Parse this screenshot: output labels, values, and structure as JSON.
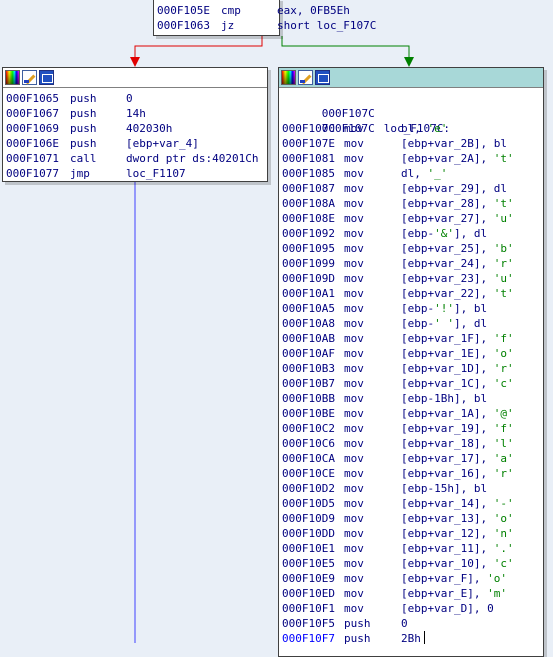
{
  "top_block": {
    "lines": [
      {
        "addr": "000F105E",
        "mn": "cmp",
        "ops": "eax, 0FB5Eh"
      },
      {
        "addr": "000F1063",
        "mn": "jz",
        "ops": "short loc_F107C"
      }
    ]
  },
  "left_block": {
    "header_icons": [
      "color-palette-icon",
      "edit-icon",
      "graph-icon"
    ],
    "lines": [
      {
        "addr": "000F1065",
        "mn": "push",
        "ops": "0"
      },
      {
        "addr": "000F1067",
        "mn": "push",
        "ops": "14h"
      },
      {
        "addr": "000F1069",
        "mn": "push",
        "ops": "402030h"
      },
      {
        "addr": "000F106E",
        "mn": "push",
        "ops": "[ebp+var_4]"
      },
      {
        "addr": "000F1071",
        "mn": "call",
        "ops": "dword ptr ds:40201Ch"
      },
      {
        "addr": "000F1077",
        "mn": "jmp",
        "ops": "loc_F1107"
      }
    ]
  },
  "right_block": {
    "header_icons": [
      "color-palette-icon",
      "edit-icon",
      "graph-icon"
    ],
    "header_color": "#a8d8d8",
    "first_addr": "000F107C",
    "label_line": {
      "addr": "000F107C",
      "label": "loc_F107C:"
    },
    "lines": [
      {
        "addr": "000F107C",
        "mn": "mov",
        "ops": "bl, 'e'"
      },
      {
        "addr": "000F107E",
        "mn": "mov",
        "ops": "[ebp+var_2B], bl"
      },
      {
        "addr": "000F1081",
        "mn": "mov",
        "ops": "[ebp+var_2A], 't'"
      },
      {
        "addr": "000F1085",
        "mn": "mov",
        "ops": "dl, '_'"
      },
      {
        "addr": "000F1087",
        "mn": "mov",
        "ops": "[ebp+var_29], dl"
      },
      {
        "addr": "000F108A",
        "mn": "mov",
        "ops": "[ebp+var_28], 't'"
      },
      {
        "addr": "000F108E",
        "mn": "mov",
        "ops": "[ebp+var_27], 'u'"
      },
      {
        "addr": "000F1092",
        "mn": "mov",
        "ops": "[ebp-'&'], dl"
      },
      {
        "addr": "000F1095",
        "mn": "mov",
        "ops": "[ebp+var_25], 'b'"
      },
      {
        "addr": "000F1099",
        "mn": "mov",
        "ops": "[ebp+var_24], 'r'"
      },
      {
        "addr": "000F109D",
        "mn": "mov",
        "ops": "[ebp+var_23], 'u'"
      },
      {
        "addr": "000F10A1",
        "mn": "mov",
        "ops": "[ebp+var_22], 't'"
      },
      {
        "addr": "000F10A5",
        "mn": "mov",
        "ops": "[ebp-'!'], bl"
      },
      {
        "addr": "000F10A8",
        "mn": "mov",
        "ops": "[ebp-' '], dl"
      },
      {
        "addr": "000F10AB",
        "mn": "mov",
        "ops": "[ebp+var_1F], 'f'"
      },
      {
        "addr": "000F10AF",
        "mn": "mov",
        "ops": "[ebp+var_1E], 'o'"
      },
      {
        "addr": "000F10B3",
        "mn": "mov",
        "ops": "[ebp+var_1D], 'r'"
      },
      {
        "addr": "000F10B7",
        "mn": "mov",
        "ops": "[ebp+var_1C], 'c'"
      },
      {
        "addr": "000F10BB",
        "mn": "mov",
        "ops": "[ebp-1Bh], bl"
      },
      {
        "addr": "000F10BE",
        "mn": "mov",
        "ops": "[ebp+var_1A], '@'"
      },
      {
        "addr": "000F10C2",
        "mn": "mov",
        "ops": "[ebp+var_19], 'f'"
      },
      {
        "addr": "000F10C6",
        "mn": "mov",
        "ops": "[ebp+var_18], 'l'"
      },
      {
        "addr": "000F10CA",
        "mn": "mov",
        "ops": "[ebp+var_17], 'a'"
      },
      {
        "addr": "000F10CE",
        "mn": "mov",
        "ops": "[ebp+var_16], 'r'"
      },
      {
        "addr": "000F10D2",
        "mn": "mov",
        "ops": "[ebp-15h], bl"
      },
      {
        "addr": "000F10D5",
        "mn": "mov",
        "ops": "[ebp+var_14], '-'"
      },
      {
        "addr": "000F10D9",
        "mn": "mov",
        "ops": "[ebp+var_13], 'o'"
      },
      {
        "addr": "000F10DD",
        "mn": "mov",
        "ops": "[ebp+var_12], 'n'"
      },
      {
        "addr": "000F10E1",
        "mn": "mov",
        "ops": "[ebp+var_11], '.'"
      },
      {
        "addr": "000F10E5",
        "mn": "mov",
        "ops": "[ebp+var_10], 'c'"
      },
      {
        "addr": "000F10E9",
        "mn": "mov",
        "ops": "[ebp+var_F], 'o'"
      },
      {
        "addr": "000F10ED",
        "mn": "mov",
        "ops": "[ebp+var_E], 'm'"
      },
      {
        "addr": "000F10F1",
        "mn": "mov",
        "ops": "[ebp+var_D], 0"
      },
      {
        "addr": "000F10F5",
        "mn": "push",
        "ops": "0"
      },
      {
        "addr": "000F10F7",
        "mn": "push",
        "ops": "2Bh"
      }
    ]
  },
  "edges": {
    "false_branch_color": "#e00000",
    "true_branch_color": "#008000",
    "unconditional_color": "#4040ff"
  }
}
